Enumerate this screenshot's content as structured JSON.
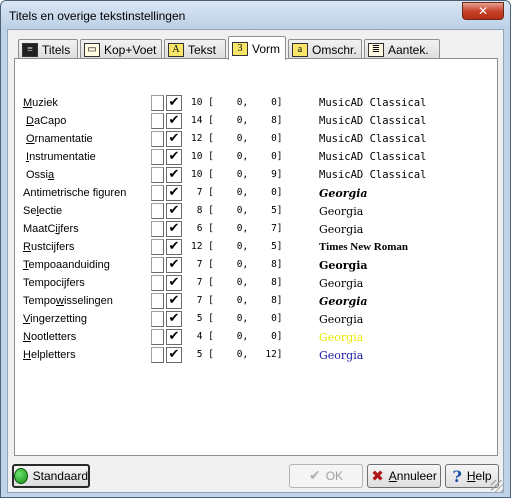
{
  "window": {
    "title": "Titels en overige tekstinstellingen",
    "close_glyph": "✕"
  },
  "tabs": [
    {
      "label": "Titels",
      "icon": "titles-icon",
      "glyph": "≡"
    },
    {
      "label": "Kop+Voet",
      "icon": "header-footer-icon",
      "glyph": "▭"
    },
    {
      "label": "Tekst",
      "icon": "text-icon",
      "glyph": "A"
    },
    {
      "label": "Vorm",
      "icon": "shape-icon",
      "glyph": "3",
      "active": true
    },
    {
      "label": "Omschr.",
      "icon": "description-icon",
      "glyph": "a"
    },
    {
      "label": "Aantek.",
      "icon": "notes-icon",
      "glyph": "≣"
    }
  ],
  "rows": [
    {
      "pre": "",
      "u": "M",
      "post": "uziek",
      "checked": "✔",
      "nums": "10 [    0,    0]",
      "font": "MusicAD Classical",
      "font_color": "#000000"
    },
    {
      "pre": "",
      "u": "D",
      "post": "aCapo",
      "checked": "✔",
      "nums": "14 [    0,    8]",
      "font": "MusicAD Classical",
      "font_color": "#000000"
    },
    {
      "pre": "",
      "u": "O",
      "post": "rnamentatie",
      "checked": "✔",
      "nums": "12 [    0,    0]",
      "font": "MusicAD Classical",
      "font_color": "#000000"
    },
    {
      "pre": "",
      "u": "I",
      "post": "nstrumentatie",
      "checked": "✔",
      "nums": "10 [    0,    0]",
      "font": "MusicAD Classical",
      "font_color": "#000000"
    },
    {
      "pre": "Ossi",
      "u": "a",
      "post": "",
      "checked": "✔",
      "nums": "10 [    0,    9]",
      "font": "MusicAD Classical",
      "font_color": "#000000"
    },
    {
      "pre": "Antimetrische figuren",
      "u": "",
      "post": "",
      "checked": "✔",
      "nums": " 7 [    0,    0]",
      "font": "Georgia",
      "font_color": "#000000"
    },
    {
      "pre": "Se",
      "u": "l",
      "post": "ectie",
      "checked": "✔",
      "nums": " 8 [    0,    5]",
      "font": "Georgia",
      "font_color": "#000000"
    },
    {
      "pre": "MaatC",
      "u": "i",
      "post": "jfers",
      "checked": "✔",
      "nums": " 6 [    0,    7]",
      "font": "Georgia",
      "font_color": "#000000"
    },
    {
      "pre": "",
      "u": "R",
      "post": "ustcijfers",
      "checked": "✔",
      "nums": "12 [    0,    5]",
      "font": "Times New Roman",
      "font_color": "#000000"
    },
    {
      "pre": "",
      "u": "T",
      "post": "empoaanduiding",
      "checked": "✔",
      "nums": " 7 [    0,    8]",
      "font": "Georgia",
      "font_color": "#000000"
    },
    {
      "pre": "Tempoci",
      "u": "j",
      "post": "fers",
      "checked": "✔",
      "nums": " 7 [    0,    8]",
      "font": "Georgia",
      "font_color": "#000000"
    },
    {
      "pre": "Tempo",
      "u": "w",
      "post": "isselingen",
      "checked": "✔",
      "nums": " 7 [    0,    8]",
      "font": "Georgia",
      "font_color": "#000000"
    },
    {
      "pre": "",
      "u": "V",
      "post": "ingerzetting",
      "checked": "✔",
      "nums": " 5 [    0,    0]",
      "font": "Georgia",
      "font_color": "#000000"
    },
    {
      "pre": "",
      "u": "N",
      "post": "ootletters",
      "checked": "✔",
      "nums": " 4 [    0,    0]",
      "font": "Georgia",
      "font_color": "#e8e800"
    },
    {
      "pre": "",
      "u": "H",
      "post": "elpletters",
      "checked": "✔",
      "nums": " 5 [    0,   12]",
      "font": "Georgia",
      "font_color": "#1a1aa0"
    }
  ],
  "buttons": {
    "standard": "Standaard",
    "ok": "OK",
    "cancel": "Annuleer",
    "cancel_u": "A",
    "help": "Help",
    "help_u": "H"
  }
}
